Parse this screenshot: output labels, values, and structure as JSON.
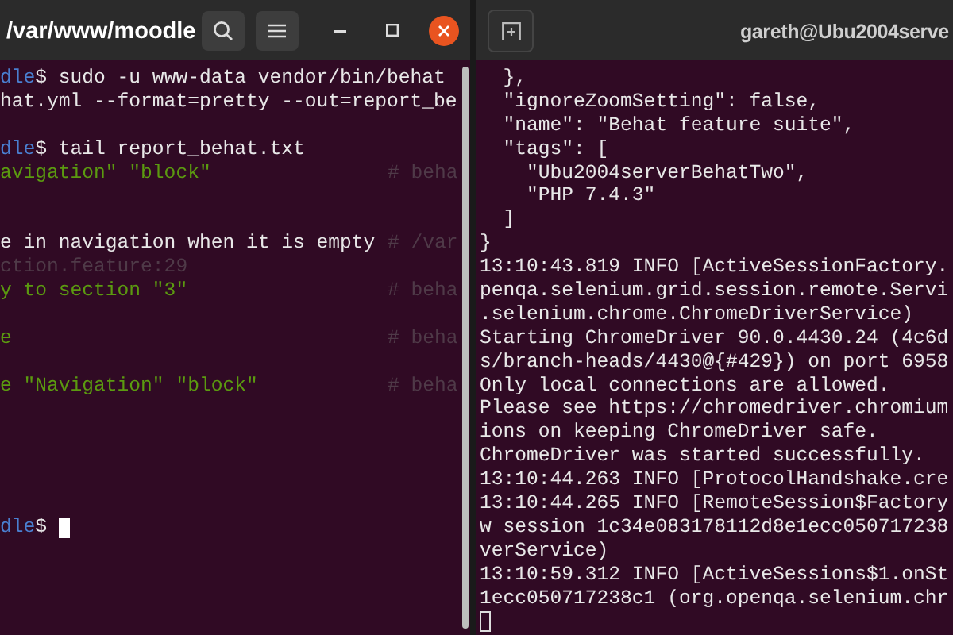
{
  "left_terminal": {
    "title": "/var/www/moodle",
    "focused": true,
    "lines": [
      {
        "kind": "text",
        "segments": [
          {
            "kind": "prompt",
            "text": "dle"
          },
          {
            "kind": "plain",
            "text": "$ sudo -u www-data vendor/bin/behat"
          }
        ]
      },
      {
        "kind": "text",
        "segments": [
          {
            "kind": "plain",
            "text": "hat.yml --format=pretty --out=report_be"
          }
        ]
      },
      {
        "kind": "blank"
      },
      {
        "kind": "text",
        "segments": [
          {
            "kind": "prompt",
            "text": "dle"
          },
          {
            "kind": "plain",
            "text": "$ tail report_behat.txt"
          }
        ]
      },
      {
        "kind": "text",
        "segments": [
          {
            "kind": "step",
            "text": "avigation\" \"block\""
          }
        ],
        "comment": "# beha"
      },
      {
        "kind": "blank"
      },
      {
        "kind": "blank"
      },
      {
        "kind": "text",
        "segments": [
          {
            "kind": "plain",
            "text": "e in navigation when it is empty"
          }
        ],
        "comment": "# /var"
      },
      {
        "kind": "text",
        "segments": [
          {
            "kind": "dim",
            "text": "ction.feature:29"
          }
        ]
      },
      {
        "kind": "text",
        "segments": [
          {
            "kind": "step",
            "text": "y to section \"3\""
          }
        ],
        "comment": "# beha"
      },
      {
        "kind": "blank"
      },
      {
        "kind": "text",
        "segments": [
          {
            "kind": "step",
            "text": "e"
          }
        ],
        "comment": "# beha"
      },
      {
        "kind": "blank"
      },
      {
        "kind": "text",
        "segments": [
          {
            "kind": "step",
            "text": "e \"Navigation\" \"block\""
          }
        ],
        "comment": "# beha"
      },
      {
        "kind": "blank"
      },
      {
        "kind": "blank"
      },
      {
        "kind": "blank"
      },
      {
        "kind": "blank"
      },
      {
        "kind": "blank"
      },
      {
        "kind": "text",
        "segments": [
          {
            "kind": "prompt",
            "text": "dle"
          },
          {
            "kind": "plain",
            "text": "$ "
          }
        ],
        "cursor": true
      }
    ]
  },
  "right_terminal": {
    "title": "gareth@Ubu2004serve",
    "focused": false,
    "lines": [
      {
        "kind": "text",
        "segments": [
          {
            "kind": "plain",
            "text": "  },"
          }
        ]
      },
      {
        "kind": "text",
        "segments": [
          {
            "kind": "plain",
            "text": "  \"ignoreZoomSetting\": false,"
          }
        ]
      },
      {
        "kind": "text",
        "segments": [
          {
            "kind": "plain",
            "text": "  \"name\": \"Behat feature suite\","
          }
        ]
      },
      {
        "kind": "text",
        "segments": [
          {
            "kind": "plain",
            "text": "  \"tags\": ["
          }
        ]
      },
      {
        "kind": "text",
        "segments": [
          {
            "kind": "plain",
            "text": "    \"Ubu2004serverBehatTwo\","
          }
        ]
      },
      {
        "kind": "text",
        "segments": [
          {
            "kind": "plain",
            "text": "    \"PHP 7.4.3\""
          }
        ]
      },
      {
        "kind": "text",
        "segments": [
          {
            "kind": "plain",
            "text": "  ]"
          }
        ]
      },
      {
        "kind": "text",
        "segments": [
          {
            "kind": "plain",
            "text": "}"
          }
        ]
      },
      {
        "kind": "text",
        "segments": [
          {
            "kind": "plain",
            "text": "13:10:43.819 INFO [ActiveSessionFactory."
          }
        ]
      },
      {
        "kind": "text",
        "segments": [
          {
            "kind": "plain",
            "text": "penqa.selenium.grid.session.remote.Servi"
          }
        ]
      },
      {
        "kind": "text",
        "segments": [
          {
            "kind": "plain",
            "text": ".selenium.chrome.ChromeDriverService)"
          }
        ]
      },
      {
        "kind": "text",
        "segments": [
          {
            "kind": "plain",
            "text": "Starting ChromeDriver 90.0.4430.24 (4c6d"
          }
        ]
      },
      {
        "kind": "text",
        "segments": [
          {
            "kind": "plain",
            "text": "s/branch-heads/4430@{#429}) on port 6958"
          }
        ]
      },
      {
        "kind": "text",
        "segments": [
          {
            "kind": "plain",
            "text": "Only local connections are allowed."
          }
        ]
      },
      {
        "kind": "text",
        "segments": [
          {
            "kind": "plain",
            "text": "Please see https://chromedriver.chromium"
          }
        ]
      },
      {
        "kind": "text",
        "segments": [
          {
            "kind": "plain",
            "text": "ions on keeping ChromeDriver safe."
          }
        ]
      },
      {
        "kind": "text",
        "segments": [
          {
            "kind": "plain",
            "text": "ChromeDriver was started successfully."
          }
        ]
      },
      {
        "kind": "text",
        "segments": [
          {
            "kind": "plain",
            "text": "13:10:44.263 INFO [ProtocolHandshake.cre"
          }
        ]
      },
      {
        "kind": "text",
        "segments": [
          {
            "kind": "plain",
            "text": "13:10:44.265 INFO [RemoteSession$Factory"
          }
        ]
      },
      {
        "kind": "text",
        "segments": [
          {
            "kind": "plain",
            "text": "w session 1c34e083178112d8e1ecc050717238"
          }
        ]
      },
      {
        "kind": "text",
        "segments": [
          {
            "kind": "plain",
            "text": "verService)"
          }
        ]
      },
      {
        "kind": "text",
        "segments": [
          {
            "kind": "plain",
            "text": "13:10:59.312 INFO [ActiveSessions$1.onSt"
          }
        ]
      },
      {
        "kind": "text",
        "segments": [
          {
            "kind": "plain",
            "text": "1ecc050717238c1 (org.openqa.selenium.chr"
          }
        ]
      },
      {
        "kind": "text",
        "cursor": true
      }
    ]
  }
}
